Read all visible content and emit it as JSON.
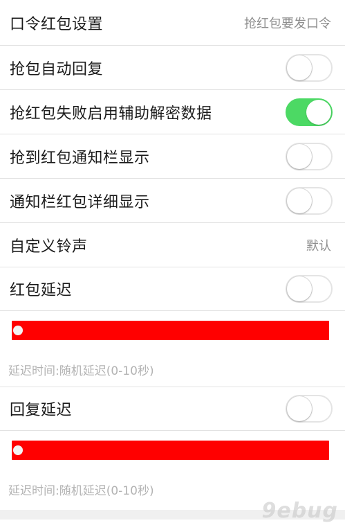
{
  "settings": {
    "password_packet": {
      "label": "口令红包设置",
      "value": "抢红包要发口令"
    },
    "auto_reply": {
      "label": "抢包自动回复",
      "enabled": false
    },
    "decrypt_assist": {
      "label": "抢红包失败启用辅助解密数据",
      "enabled": true
    },
    "notify_bar": {
      "label": "抢到红包通知栏显示",
      "enabled": false
    },
    "notify_detail": {
      "label": "通知栏红包详细显示",
      "enabled": false
    },
    "ringtone": {
      "label": "自定义铃声",
      "value": "默认"
    },
    "packet_delay": {
      "label": "红包延迟",
      "enabled": false,
      "slider_value": 0,
      "hint": "延迟时间:随机延迟(0-10秒)"
    },
    "reply_delay": {
      "label": "回复延迟",
      "enabled": false,
      "slider_value": 0,
      "hint": "延迟时间:随机延迟(0-10秒)"
    }
  },
  "colors": {
    "toggle_on": "#4cd964",
    "slider_track": "#ff0000"
  },
  "watermark": "9ebug"
}
